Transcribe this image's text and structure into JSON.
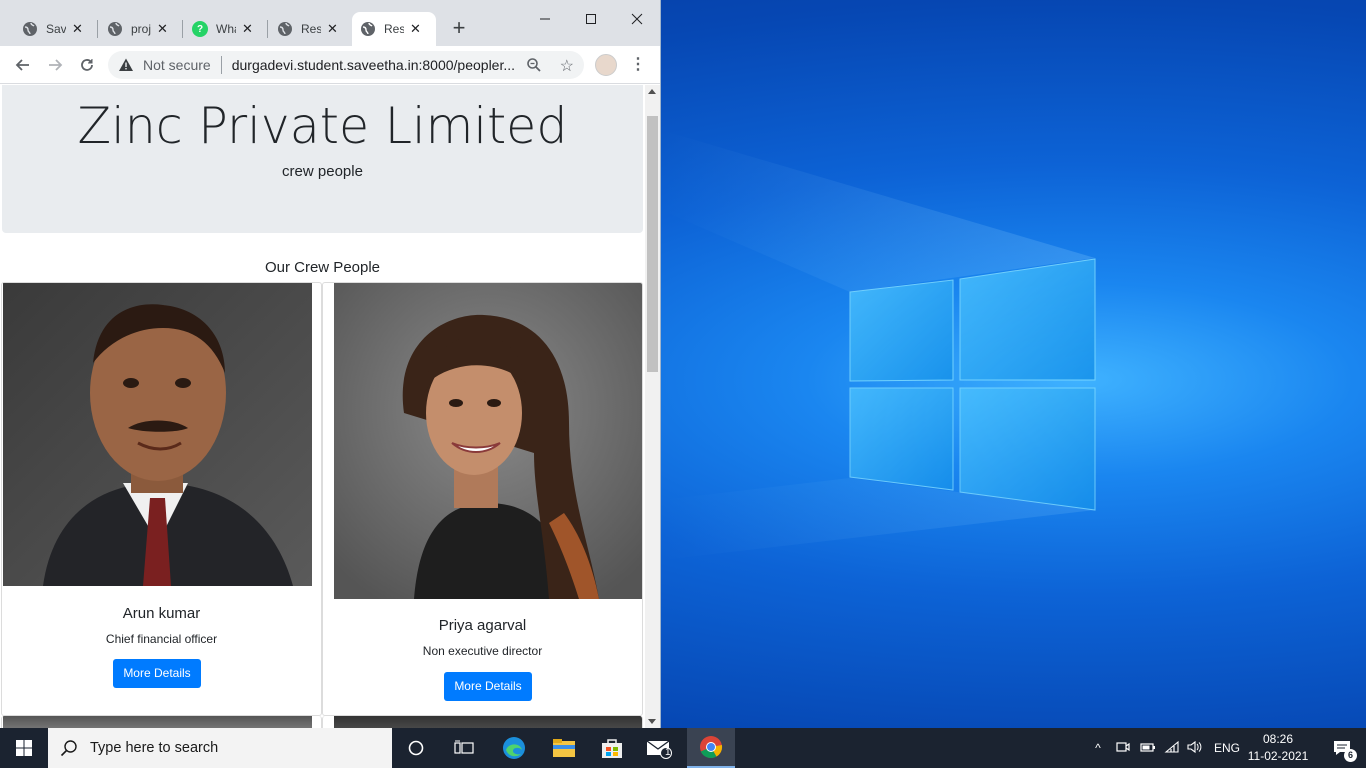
{
  "browser": {
    "tabs": [
      {
        "label": "Save",
        "icon": "globe-icon",
        "active": false
      },
      {
        "label": "proj",
        "icon": "globe-icon",
        "active": false
      },
      {
        "label": "Wha",
        "icon": "whatsapp-icon",
        "active": false
      },
      {
        "label": "Resp",
        "icon": "globe-icon",
        "active": false
      },
      {
        "label": "Resp",
        "icon": "globe-icon",
        "active": true
      }
    ],
    "address": {
      "security": "Not secure",
      "url": "durgadevi.student.saveetha.in:8000/peopler..."
    }
  },
  "page": {
    "company_title": "Zinc Private Limited",
    "company_subtitle": "crew people",
    "section_title": "Our Crew People",
    "people": [
      {
        "name": "Arun kumar",
        "role": "Chief financial officer",
        "button": "More Details"
      },
      {
        "name": "Priya agarval",
        "role": "Non executive director",
        "button": "More Details"
      }
    ]
  },
  "taskbar": {
    "search_placeholder": "Type here to search",
    "mail_badge": "1",
    "language": "ENG",
    "time": "08:26",
    "date": "11-02-2021",
    "notification_count": "6"
  },
  "colors": {
    "primary_button": "#007bff",
    "jumbotron_bg": "#e9ecef",
    "taskbar_bg": "#1b2330",
    "desktop_accent": "#1a86f0"
  }
}
